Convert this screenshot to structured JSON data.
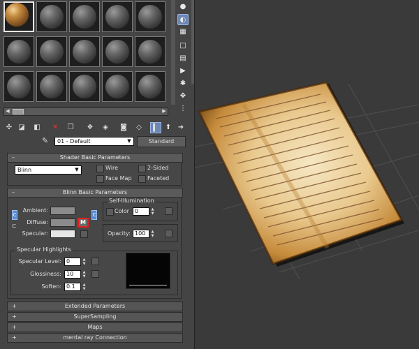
{
  "material": {
    "name": "01 - Default",
    "type_button": "Standard"
  },
  "shader_rollout": {
    "title": "Shader Basic Parameters",
    "shader": "Blinn",
    "options": {
      "wire": "Wire",
      "two_sided": "2-Sided",
      "face_map": "Face Map",
      "faceted": "Faceted"
    }
  },
  "blinn_rollout": {
    "title": "Blinn Basic Parameters",
    "ambient": "Ambient:",
    "diffuse": "Diffuse:",
    "specular": "Specular:",
    "map_button": "M",
    "self_illum": {
      "title": "Self-Illumination",
      "color_label": "Color",
      "value": "0"
    },
    "opacity": {
      "label": "Opacity:",
      "value": "100"
    },
    "highlights": {
      "title": "Specular Highlights",
      "specular_level_label": "Specular Level:",
      "specular_level": "0",
      "glossiness_label": "Glossiness:",
      "glossiness": "10",
      "soften_label": "Soften:",
      "soften": "0.1"
    }
  },
  "collapsed_rollouts": [
    {
      "label": "Extended Parameters"
    },
    {
      "label": "SuperSampling"
    },
    {
      "label": "Maps"
    },
    {
      "label": "mental ray Connection"
    }
  ],
  "signs": {
    "minus": "–",
    "plus": "+"
  },
  "colors": {
    "panel": "#444444",
    "active_button": "#6c86b6",
    "map_highlight": "#e32020",
    "viewport": "#3a3a3a"
  },
  "icons": {
    "right_toolbar": [
      "sample-type-icon",
      "backlight-icon",
      "background-icon",
      "sample-uv-tiling-icon",
      "video-color-check-icon",
      "make-preview-icon",
      "options-icon",
      "select-by-material-icon",
      "material-map-navigator-icon"
    ],
    "bottom_toolbar": [
      "get-material-icon",
      "put-to-scene-icon",
      "assign-to-selection-icon",
      "reset-map-icon",
      "copy-material-icon",
      "make-unique-icon",
      "put-to-library-icon",
      "material-id-channel-icon",
      "show-map-in-viewport-icon",
      "show-end-result-icon",
      "go-to-parent-icon",
      "go-forward-icon"
    ]
  }
}
